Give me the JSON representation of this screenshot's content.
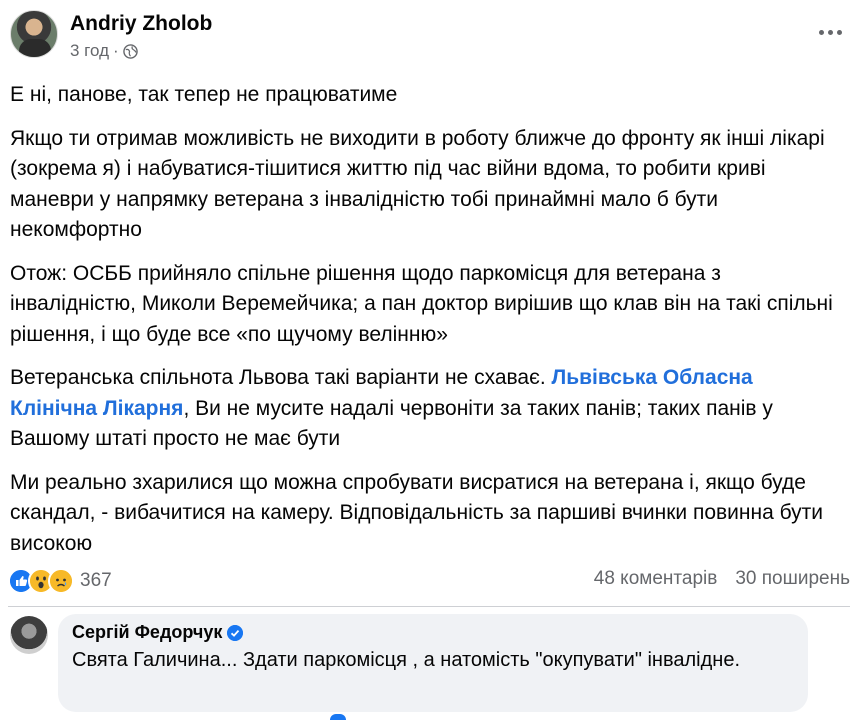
{
  "post": {
    "author": "Andriy Zholob",
    "time": "3 год",
    "visibility_icon": "globe-icon",
    "paragraphs": {
      "p1": "Е ні, панове, так тепер не працюватиме",
      "p2": "Якщо ти отримав можливість не виходити в роботу ближче до фронту як інші лікарі (зокрема я) і набуватися-тішитися життю під час війни вдома, то робити криві маневри у напрямку ветерана з інвалідністю тобі принаймні мало б бути некомфортно",
      "p3": "Отож: ОСББ прийняло спільне рішення щодо паркомісця для ветерана з інвалідністю, Миколи Веремейчика; а пан доктор вирішив що клав він на такі спільні рішення, і що буде все «по щучому велінню»",
      "p4_before": "Ветеранська спільнота Львова такі варіанти не схаває. ",
      "p4_link": "Львівська Обласна Клінічна Лікарня",
      "p4_after": ", Ви не мусите надалі червоніти за таких панів; таких панів у Вашому штаті просто не має бути",
      "p5": "Ми реально зхарилися що можна спробувати висратися на ветерана і, якщо буде скандал, - вибачитися на камеру. Відповідальність за паршиві вчинки повинна бути високою"
    }
  },
  "stats": {
    "reaction_count": "367",
    "reaction_icons": [
      "like-icon",
      "wow-icon",
      "sad-icon"
    ],
    "comments": "48 коментарів",
    "shares": "30 поширень"
  },
  "comment": {
    "author": "Сергій Федорчук",
    "text": "Свята Галичина... Здати паркомісця , а натомість \"окупувати\" інвалідне."
  },
  "colors": {
    "link": "#216fdb",
    "secondary_text": "#65676b",
    "like_blue": "#1877f2",
    "bubble_bg": "#f0f2f5"
  }
}
